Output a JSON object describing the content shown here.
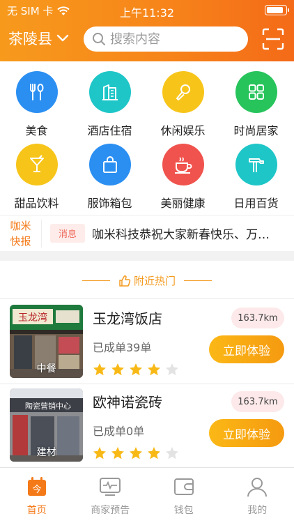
{
  "status_bar": {
    "carrier": "无 SIM 卡",
    "time": "上午11:32",
    "battery_level": 0.9
  },
  "header": {
    "city": "茶陵县",
    "search_placeholder": "搜索内容"
  },
  "categories": [
    {
      "label": "美食",
      "icon": "fork-spoon-icon",
      "color": "#2b8ff2"
    },
    {
      "label": "酒店住宿",
      "icon": "hotel-icon",
      "color": "#1ec6c8"
    },
    {
      "label": "休闲娱乐",
      "icon": "microphone-icon",
      "color": "#f7c51a"
    },
    {
      "label": "时尚居家",
      "icon": "grid-icon",
      "color": "#27c45c"
    },
    {
      "label": "甜品饮料",
      "icon": "cocktail-icon",
      "color": "#f7c51a"
    },
    {
      "label": "服饰箱包",
      "icon": "bag-icon",
      "color": "#2b8ff2"
    },
    {
      "label": "美丽健康",
      "icon": "cup-icon",
      "color": "#f0534d"
    },
    {
      "label": "日用百货",
      "icon": "tools-icon",
      "color": "#1ec6c8"
    }
  ],
  "news": {
    "brand_line1": "咖米",
    "brand_line2": "快报",
    "tag": "消息",
    "text": "咖米科技恭祝大家新春快乐、万事如意"
  },
  "hot": {
    "title": "附近热门"
  },
  "shops": [
    {
      "name": "玉龙湾饭店",
      "orders": "已成单39单",
      "distance": "163.7km",
      "category": "中餐",
      "rating": 4,
      "button": "立即体验"
    },
    {
      "name": "欧神诺瓷砖",
      "orders": "已成单0单",
      "distance": "163.7km",
      "category": "建材",
      "rating": 4,
      "button": "立即体验"
    }
  ],
  "tabs": [
    {
      "label": "首页",
      "icon": "calendar-home-icon",
      "active": true
    },
    {
      "label": "商家预告",
      "icon": "pulse-screen-icon",
      "active": false
    },
    {
      "label": "钱包",
      "icon": "wallet-icon",
      "active": false
    },
    {
      "label": "我的",
      "icon": "user-icon",
      "active": false
    }
  ],
  "colors": {
    "accent": "#f47a19",
    "button": "#f9a914"
  }
}
